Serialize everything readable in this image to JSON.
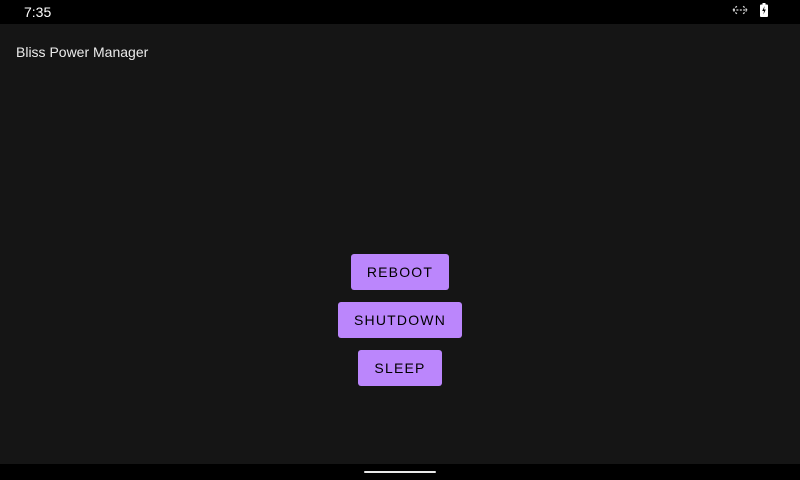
{
  "status_bar": {
    "time": "7:35",
    "icons": [
      "data-transfer-icon",
      "battery-charging-icon"
    ]
  },
  "app": {
    "title": "Bliss Power Manager"
  },
  "buttons": {
    "reboot_label": "REBOOT",
    "shutdown_label": "SHUTDOWN",
    "sleep_label": "SLEEP"
  },
  "colors": {
    "accent": "#bb86fc",
    "background": "#151515",
    "bars": "#000000"
  }
}
